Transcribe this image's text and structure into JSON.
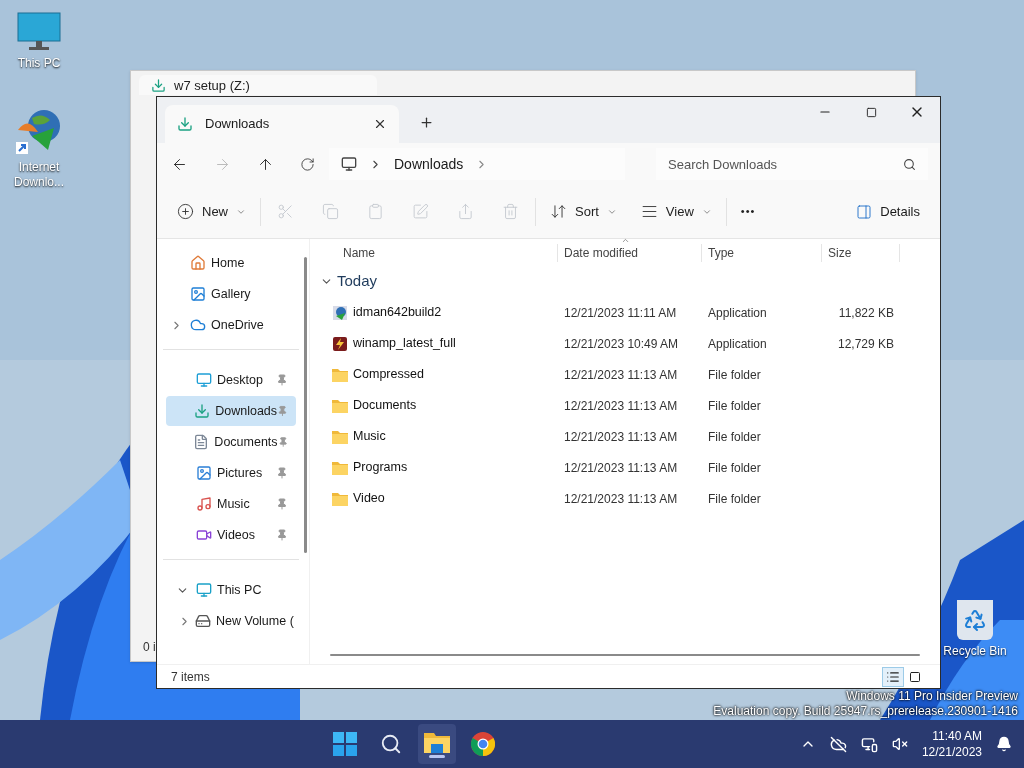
{
  "desktop_icons": [
    {
      "label": "This PC",
      "kind": "computer"
    },
    {
      "label": "Internet Downlo...",
      "kind": "shortcut"
    },
    {
      "label": "Recycle Bin",
      "kind": "recycle"
    }
  ],
  "back_window": {
    "tab_title": "w7 setup (Z:)",
    "status": "0 i"
  },
  "window": {
    "tabs": [
      {
        "title": "Downloads",
        "selected": true
      }
    ],
    "breadcrumb": [
      "Downloads"
    ],
    "search": {
      "placeholder": "Search Downloads"
    },
    "toolbar": [
      {
        "kind": "new",
        "label": "New",
        "disabled": false
      },
      {
        "kind": "cut",
        "disabled": true
      },
      {
        "kind": "copy",
        "disabled": true
      },
      {
        "kind": "paste",
        "disabled": true
      },
      {
        "kind": "rename",
        "disabled": true
      },
      {
        "kind": "share",
        "disabled": true
      },
      {
        "kind": "delete",
        "disabled": true
      },
      {
        "kind": "sort",
        "label": "Sort",
        "disabled": false
      },
      {
        "kind": "view",
        "label": "View",
        "disabled": false
      },
      {
        "kind": "more",
        "label": "•••",
        "disabled": false
      }
    ],
    "details_button": "Details",
    "sidebar": [
      [
        {
          "label": "Home",
          "kind": "home",
          "selected": false
        },
        {
          "label": "Gallery",
          "kind": "gallery",
          "selected": false
        },
        {
          "label": "OneDrive",
          "kind": "cloud",
          "selected": false,
          "expanded": false
        }
      ],
      [
        {
          "label": "Desktop",
          "kind": "desktop",
          "pinned": true,
          "selected": false
        },
        {
          "label": "Downloads",
          "kind": "download",
          "pinned": true,
          "selected": true
        },
        {
          "label": "Documents",
          "kind": "document",
          "pinned": true,
          "selected": false
        },
        {
          "label": "Pictures",
          "kind": "picture",
          "pinned": true,
          "selected": false
        },
        {
          "label": "Music",
          "kind": "music",
          "pinned": true,
          "selected": false
        },
        {
          "label": "Videos",
          "kind": "video",
          "pinned": true,
          "selected": false
        }
      ],
      [
        {
          "label": "This PC",
          "kind": "computer",
          "selected": false,
          "expanded": true,
          "children": [
            {
              "label": "New Volume (",
              "kind": "drive",
              "selected": false,
              "expanded": false
            }
          ]
        }
      ]
    ],
    "columns": [
      "Name",
      "Date modified",
      "Type",
      "Size"
    ],
    "group": {
      "label": "Today",
      "expanded": true
    },
    "rows": [
      {
        "name": "idman642build2",
        "kind": "installer",
        "date": "12/21/2023 11:11 AM",
        "type": "Application",
        "size": "11,822 KB"
      },
      {
        "name": "winamp_latest_full",
        "kind": "player",
        "date": "12/21/2023 10:49 AM",
        "type": "Application",
        "size": "12,729 KB"
      },
      {
        "name": "Compressed",
        "kind": "folder",
        "date": "12/21/2023 11:13 AM",
        "type": "File folder"
      },
      {
        "name": "Documents",
        "kind": "folder",
        "date": "12/21/2023 11:13 AM",
        "type": "File folder"
      },
      {
        "name": "Music",
        "kind": "folder",
        "date": "12/21/2023 11:13 AM",
        "type": "File folder"
      },
      {
        "name": "Programs",
        "kind": "folder",
        "date": "12/21/2023 11:13 AM",
        "type": "File folder"
      },
      {
        "name": "Video",
        "kind": "folder",
        "date": "12/21/2023 11:13 AM",
        "type": "File folder"
      }
    ],
    "status": "7 items",
    "views": [
      {
        "kind": "details",
        "selected": true
      },
      {
        "kind": "tiles",
        "selected": false
      }
    ]
  },
  "os_notice": [
    "Windows 11 Pro Insider Preview",
    "Evaluation copy. Build 25947.rs_prerelease.230901-1416"
  ],
  "taskbar": {
    "apps": [
      {
        "kind": "start",
        "selected": false
      },
      {
        "kind": "search",
        "selected": false
      },
      {
        "kind": "explorer",
        "selected": true
      },
      {
        "kind": "browser",
        "selected": false
      }
    ],
    "time": "11:40 AM",
    "date": "12/21/2023"
  }
}
